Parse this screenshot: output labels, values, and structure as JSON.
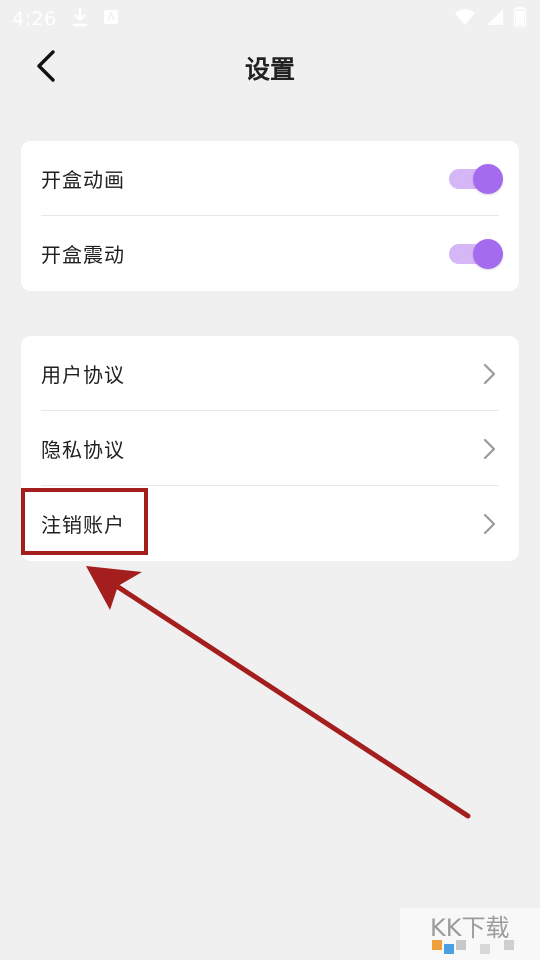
{
  "status_bar": {
    "time": "4:26",
    "icons": [
      "download-icon",
      "notification-icon",
      "wifi-icon",
      "signal-icon",
      "battery-icon"
    ]
  },
  "app_bar": {
    "title": "设置",
    "back_icon": "back-arrow-icon"
  },
  "settings": {
    "toggles": [
      {
        "label": "开盒动画",
        "on": true
      },
      {
        "label": "开盒震动",
        "on": true
      }
    ],
    "links": [
      {
        "label": "用户协议"
      },
      {
        "label": "隐私协议"
      },
      {
        "label": "注销账户"
      }
    ]
  },
  "colors": {
    "background": "#f1f0f1",
    "toggle_track": "#d5b6f6",
    "toggle_thumb": "#a46bef",
    "annotation_red": "#a41e1e"
  },
  "annotation": {
    "highlighted_item": "注销账户"
  },
  "watermark": {
    "text": "KK下载"
  }
}
